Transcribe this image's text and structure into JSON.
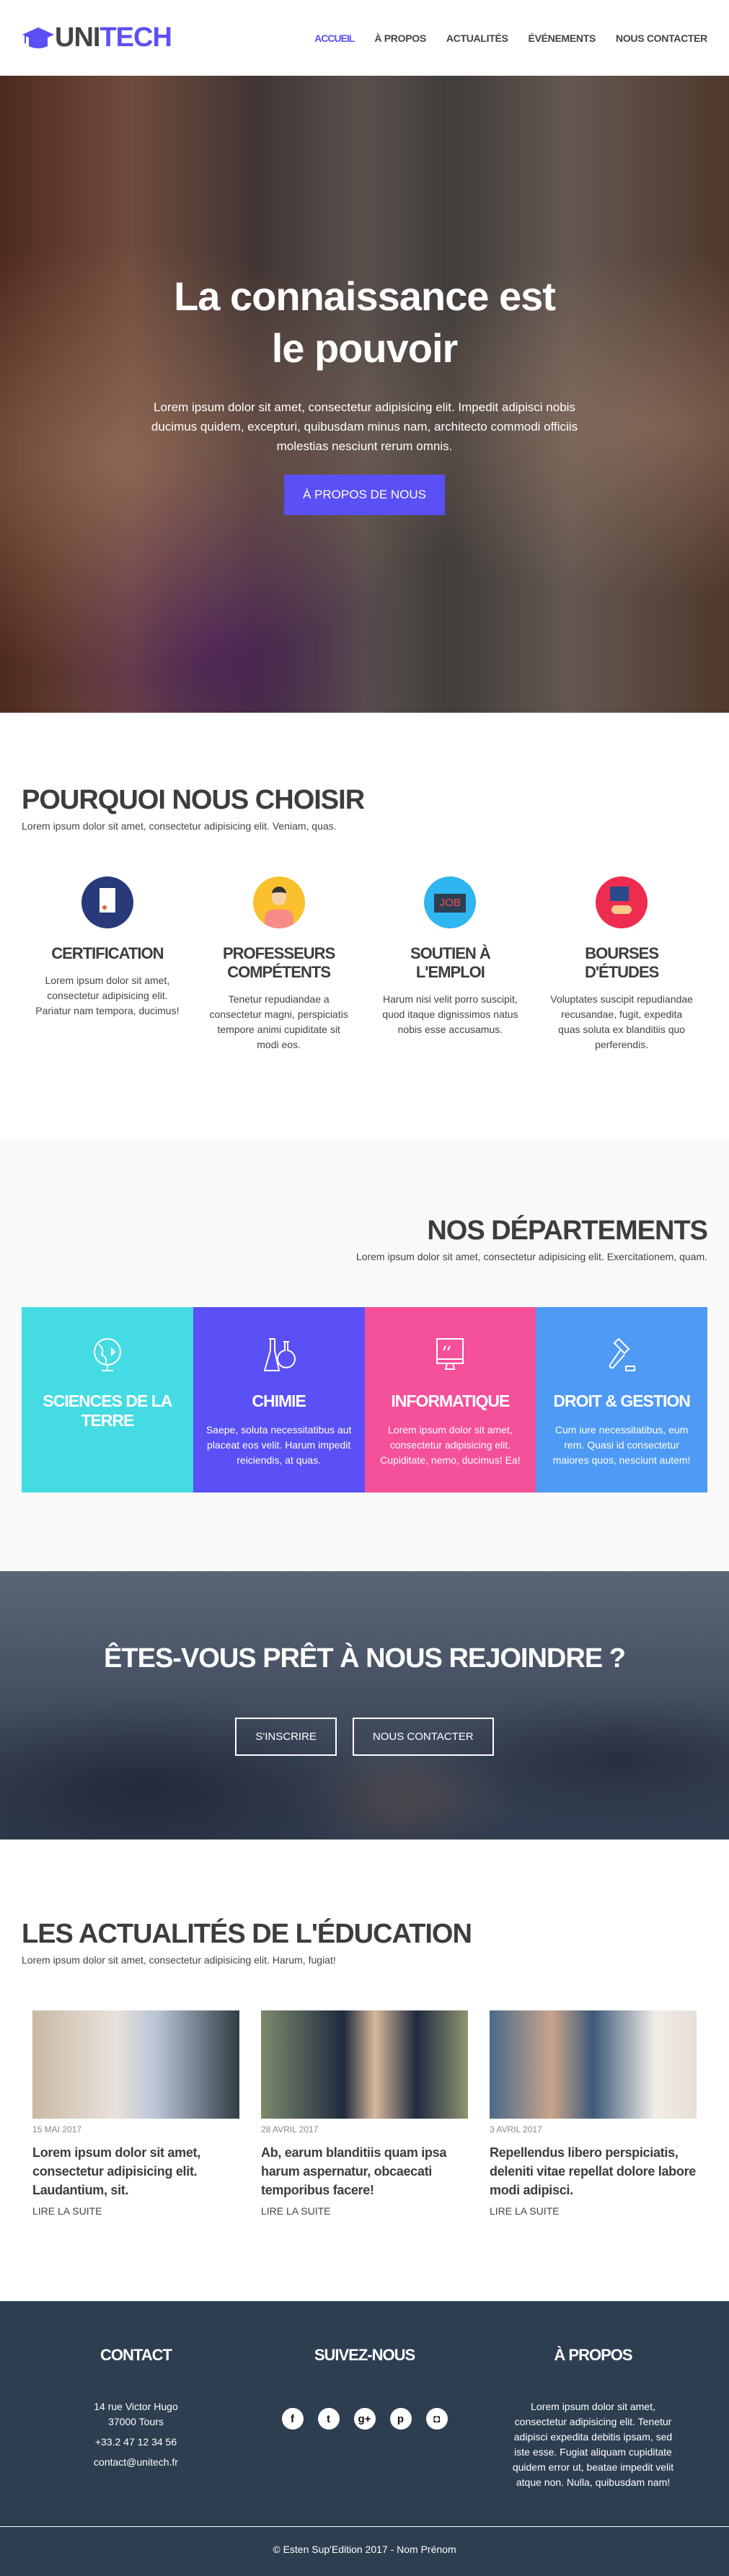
{
  "header": {
    "logo_a": "UNI",
    "logo_b": "TECH",
    "nav": [
      "ACCUEIL",
      "À PROPOS",
      "ACTUALITÉS",
      "ÉVÉNEMENTS",
      "NOUS CONTACTER"
    ]
  },
  "hero": {
    "title": "La connaissance est le pouvoir",
    "text": "Lorem ipsum dolor sit amet, consectetur adipisicing elit. Impedit adipisci nobis ducimus quidem, excepturi, quibusdam minus nam, architecto commodi officiis molestias nesciunt rerum omnis.",
    "button": "À PROPOS DE NOUS"
  },
  "why": {
    "title": "POURQUOI NOUS CHOISIR",
    "subtitle": "Lorem ipsum dolor sit amet, consectetur adipisicing elit. Veniam, quas.",
    "items": [
      {
        "title": "CERTIFICATION",
        "text": "Lorem ipsum dolor sit amet, consectetur adipisicing elit. Pariatur nam tempora, ducimus!",
        "color": "#283a7a"
      },
      {
        "title": "PROFESSEURS COMPÉTENTS",
        "text": "Tenetur repudiandae a consectetur magni, perspiciatis tempore animi cupiditate sit modi eos.",
        "color": "#fbc02d"
      },
      {
        "title": "SOUTIEN À L'EMPLOI",
        "text": "Harum nisi velit porro suscipit, quod itaque dignissimos natus nobis esse accusamus.",
        "color": "#2fb5f0"
      },
      {
        "title": "BOURSES D'ÉTUDES",
        "text": "Voluptates suscipit repudiandae recusandae, fugit, expedita quas soluta ex blanditiis quo perferendis.",
        "color": "#ee2c50"
      }
    ]
  },
  "departments": {
    "title": "NOS DÉPARTEMENTS",
    "subtitle": "Lorem ipsum dolor sit amet, consectetur adipisicing elit. Exercitationem, quam.",
    "items": [
      {
        "title": "SCIENCES DE LA TERRE",
        "text": "",
        "color": "#45dbe2"
      },
      {
        "title": "CHIMIE",
        "text": "Saepe, soluta necessitatibus aut placeat eos velit. Harum impedit reiciendis, at quas.",
        "color": "#5a50f5"
      },
      {
        "title": "INFORMATIQUE",
        "text": "Lorem ipsum dolor sit amet, consectetur adipisicing elit. Cupiditate, nemo, ducimus! Ea!",
        "color": "#f5509a"
      },
      {
        "title": "DROIT & GESTION",
        "text": "Cum iure necessitatibus, eum rem. Quasi id consectetur maiores quos, nesciunt autem!",
        "color": "#4f9af5"
      }
    ]
  },
  "cta": {
    "title": "ÊTES-VOUS PRÊT À NOUS REJOINDRE ?",
    "signup": "S'INSCRIRE",
    "contact": "NOUS CONTACTER"
  },
  "news": {
    "title": "LES ACTUALITÉS DE L'ÉDUCATION",
    "subtitle": "Lorem ipsum dolor sit amet, consectetur adipisicing elit. Harum, fugiat!",
    "posts": [
      {
        "date": "15 MAI 2017",
        "title": "Lorem ipsum dolor sit amet, consectetur adipisicing elit. Laudantium, sit.",
        "link": "LIRE LA SUITE"
      },
      {
        "date": "28 AVRIL 2017",
        "title": "Ab, earum blanditiis quam ipsa harum aspernatur, obcaecati temporibus facere!",
        "link": "LIRE LA SUITE"
      },
      {
        "date": "3 AVRIL 2017",
        "title": "Repellendus libero perspiciatis, deleniti vitae repellat dolore labore modi adipisci.",
        "link": "LIRE LA SUITE"
      }
    ]
  },
  "footer": {
    "contact_title": "CONTACT",
    "address1": "14 rue Victor Hugo",
    "address2": "37000 Tours",
    "phone": "+33.2 47 12 34 56",
    "email": "contact@unitech.fr",
    "follow_title": "SUIVEZ-NOUS",
    "about_title": "À PROPOS",
    "about_text": "Lorem ipsum dolor sit amet, consectetur adipisicing elit. Tenetur adipisci expedita debitis ipsam, sed iste esse. Fugiat aliquam cupiditate quidem error ut, beatae impedit velit atque non. Nulla, quibusdam nam!",
    "copyright": "© Esten Sup'Edition 2017 - Nom Prénom"
  }
}
